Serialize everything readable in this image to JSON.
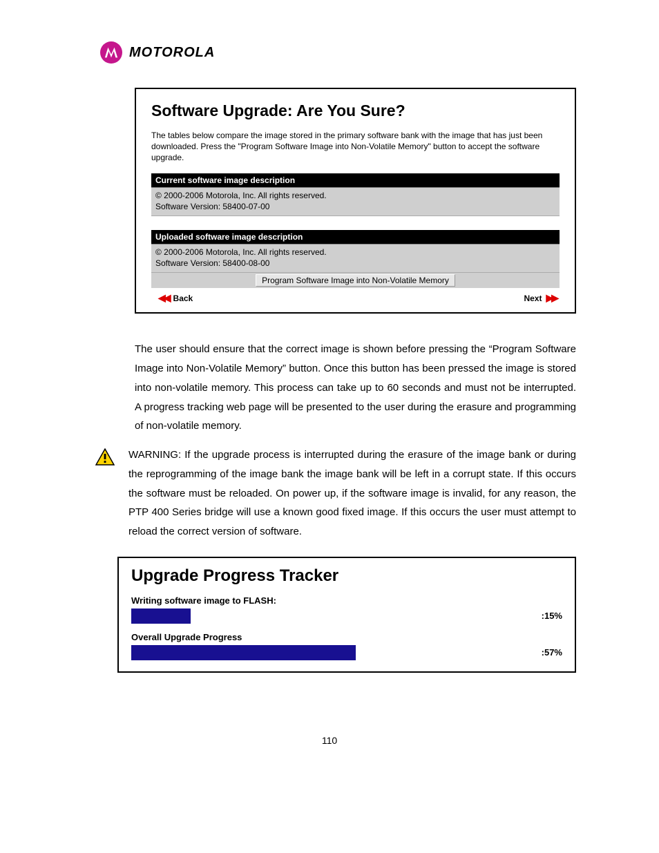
{
  "brand": "MOTOROLA",
  "panel1": {
    "title": "Software Upgrade: Are You Sure?",
    "intro": "The tables below compare the image stored in the primary software bank with the image that has just been downloaded. Press the \"Program Software Image into Non-Volatile Memory\" button to accept the software upgrade.",
    "current_header": "Current software image description",
    "current_line1": "© 2000-2006 Motorola, Inc. All rights reserved.",
    "current_line2": "Software Version: 58400-07-00",
    "uploaded_header": "Uploaded software image description",
    "uploaded_line1": "© 2000-2006 Motorola, Inc. All rights reserved.",
    "uploaded_line2": "Software Version: 58400-08-00",
    "button_label": "Program Software Image into Non-Volatile Memory",
    "back": "Back",
    "next": "Next"
  },
  "para1": "The user should ensure that the correct image is shown before pressing the “Program Software Image into Non-Volatile Memory” button. Once this button has been pressed the image is stored into non-volatile memory. This process can take up to 60 seconds and must not be interrupted. A progress tracking web page will be presented to the user during the erasure and programming of non-volatile memory.",
  "warning": "WARNING: If the upgrade process is interrupted during the erasure of the image bank or during the reprogramming of the image bank the image bank will be left in a corrupt state. If this occurs the software must be reloaded. On power up, if the software image is invalid, for any reason, the PTP 400 Series bridge will use a known good fixed image. If this occurs the user must attempt to reload the correct version of software.",
  "panel2": {
    "title": "Upgrade Progress Tracker",
    "writing_label": "Writing software image to FLASH:",
    "writing_pct_text": ":15%",
    "writing_pct_value": 15,
    "overall_label": "Overall Upgrade Progress",
    "overall_pct_text": ":57%",
    "overall_pct_value": 57
  },
  "page_number": "110"
}
